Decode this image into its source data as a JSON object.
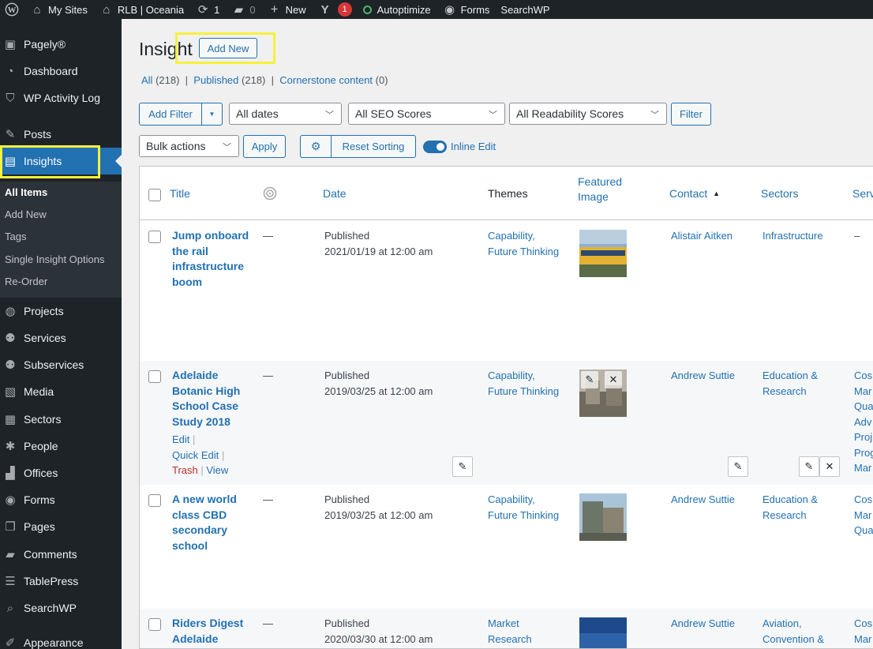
{
  "adminbar": {
    "my_sites": "My Sites",
    "site_name": "RLB | Oceania",
    "updates_count": "1",
    "comments_count": "0",
    "new_label": "New",
    "yoast_count": "1",
    "autoptimize": "Autoptimize",
    "forms": "Forms",
    "searchwp": "SearchWP"
  },
  "sidebar": {
    "items": [
      {
        "label": "Pagely®",
        "icon": "pagely-icon"
      },
      {
        "label": "Dashboard",
        "icon": "dashboard-icon"
      },
      {
        "label": "WP Activity Log",
        "icon": "shield-icon"
      },
      {
        "label": "Posts",
        "icon": "pin-icon"
      },
      {
        "label": "Insights",
        "icon": "document-icon"
      },
      {
        "label": "Projects",
        "icon": "globe-icon"
      },
      {
        "label": "Services",
        "icon": "users-icon"
      },
      {
        "label": "Subservices",
        "icon": "users-icon"
      },
      {
        "label": "Media",
        "icon": "media-icon"
      },
      {
        "label": "Sectors",
        "icon": "grid-icon"
      },
      {
        "label": "People",
        "icon": "person-icon"
      },
      {
        "label": "Offices",
        "icon": "buildings-icon"
      },
      {
        "label": "Forms",
        "icon": "forms-icon"
      },
      {
        "label": "Pages",
        "icon": "pages-icon"
      },
      {
        "label": "Comments",
        "icon": "comment-icon"
      },
      {
        "label": "TablePress",
        "icon": "table-icon"
      },
      {
        "label": "SearchWP",
        "icon": "search-icon"
      },
      {
        "label": "Appearance",
        "icon": "brush-icon"
      }
    ],
    "submenu": [
      "All Items",
      "Add New",
      "Tags",
      "Single Insight Options",
      "Re-Order"
    ]
  },
  "page": {
    "title": "Insight",
    "add_new": "Add New",
    "views": {
      "all": "All",
      "all_count": "(218)",
      "published": "Published",
      "published_count": "(218)",
      "cornerstone": "Cornerstone content",
      "cornerstone_count": "(0)"
    },
    "filters": {
      "add_filter": "Add Filter",
      "dates": "All dates",
      "seo": "All SEO Scores",
      "readability": "All Readability Scores",
      "filter_btn": "Filter"
    },
    "bulk": {
      "bulk_actions": "Bulk actions",
      "apply": "Apply",
      "reset_sorting": "Reset Sorting",
      "inline_edit": "Inline Edit"
    }
  },
  "table": {
    "columns": {
      "title": "Title",
      "date": "Date",
      "themes": "Themes",
      "featured_line1": "Featured",
      "featured_line2": "Image",
      "contact": "Contact",
      "sectors": "Sectors",
      "services": "Serv"
    },
    "row_actions": {
      "edit": "Edit",
      "quick_edit": "Quick Edit",
      "trash": "Trash",
      "view": "View"
    },
    "rows": [
      {
        "title": "Jump onboard the rail infrastructure boom",
        "seo": "—",
        "status": "Published",
        "date": "2021/01/19 at 12:00 am",
        "theme1": "Capability,",
        "theme2": "Future Thinking",
        "contact": "Alistair Aitken",
        "sector1": "Infrastructure",
        "sector2": "",
        "services": [
          "–"
        ],
        "thumb_colors": [
          "#7aa0c8",
          "#e0b030",
          "#4a6a3a"
        ]
      },
      {
        "title": "Adelaide Botanic High School Case Study 2018",
        "seo": "—",
        "status": "Published",
        "date": "2019/03/25 at 12:00 am",
        "theme1": "Capability,",
        "theme2": "Future Thinking",
        "contact": "Andrew Suttie",
        "sector1": "Education &",
        "sector2": "Research",
        "services": [
          "Cos",
          "Mar",
          "Qua",
          "Adv",
          "Proj",
          "Prog",
          "Mar"
        ],
        "thumb_colors": [
          "#c9c6bd",
          "#8a8478",
          "#5c5a52"
        ]
      },
      {
        "title": "A new world class CBD secondary school",
        "seo": "—",
        "status": "Published",
        "date": "2019/03/25 at 12:00 am",
        "theme1": "Capability,",
        "theme2": "Future Thinking",
        "contact": "Andrew Suttie",
        "sector1": "Education &",
        "sector2": "Research",
        "services": [
          "Cos",
          "Mar",
          "Qua"
        ],
        "thumb_colors": [
          "#8fb0cc",
          "#6b7d72",
          "#a79f8e"
        ]
      },
      {
        "title": "Riders Digest Adelaide",
        "seo": "—",
        "status": "Published",
        "date": "2020/03/30 at 12:00 am",
        "theme1": "Market",
        "theme2": "Research",
        "contact": "Andrew Suttie",
        "sector1": "Aviation,",
        "sector2": "Convention &",
        "services": [
          "Cos",
          "Mar"
        ],
        "thumb_colors": [
          "#1e4a8c",
          "#2d62a8",
          "#163a70"
        ]
      }
    ]
  }
}
